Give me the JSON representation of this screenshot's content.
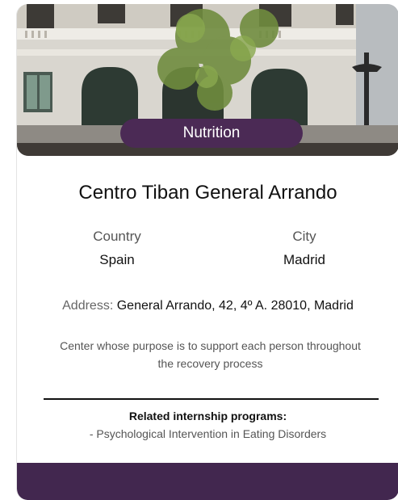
{
  "card": {
    "category_badge": "Nutrition",
    "title": "Centro Tiban General Arrando",
    "country": {
      "label": "Country",
      "value": "Spain"
    },
    "city": {
      "label": "City",
      "value": "Madrid"
    },
    "address": {
      "label": "Address:",
      "value": "General Arrando, 42, 4º A. 28010, Madrid"
    },
    "description": "Center whose purpose is to support each person throughout the recovery process",
    "related": {
      "heading": "Related internship programs:",
      "items": [
        "- Psychological Intervention in Eating Disorders"
      ]
    }
  },
  "colors": {
    "badge": "#4b2a55",
    "footer": "#42274f"
  }
}
